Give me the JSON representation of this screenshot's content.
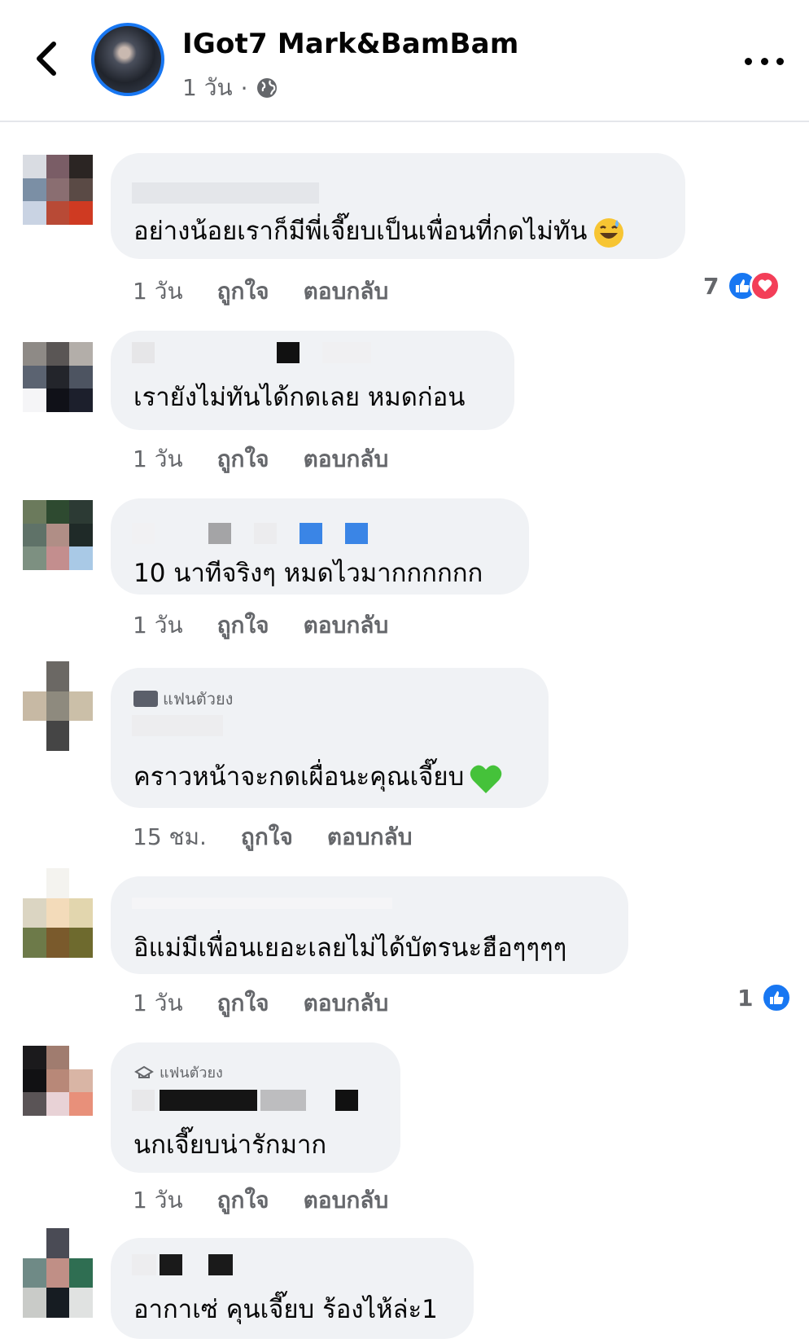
{
  "header": {
    "page_name": "IGot7 Mark&BamBam",
    "time": "1 วัน",
    "separator": "·",
    "back_icon": "chevron-left-icon",
    "privacy_icon": "globe-icon",
    "more_icon": "more-dots-icon"
  },
  "actions": {
    "like": "ถูกใจ",
    "reply": "ตอบกลับ"
  },
  "comments": [
    {
      "text": "อย่างน้อยเราก็มีพี่เจี๊ยบเป็นเพื่อนที่กดไม่ทัน",
      "time": "1 วัน",
      "emoji": "grinning-sweat-emoji",
      "reactions": {
        "count": "7",
        "types": [
          "like",
          "love"
        ]
      }
    },
    {
      "text": "เรายังไม่ทันได้กดเลย หมดก่อน",
      "time": "1 วัน"
    },
    {
      "text": "10 นาทีจริงๆ หมดไวมากกกกกก",
      "time": "1 วัน"
    },
    {
      "fan_badge": "แฟนตัวยง",
      "text": "คราวหน้าจะกดเผื่อนะคุณเจี๊ยบ",
      "time": "15 ชม.",
      "emoji": "green-heart-emoji"
    },
    {
      "text": "อิแม่มีเพื่อนเยอะเลยไม่ได้บัตรนะฮือๆๆๆๆ",
      "time": "1 วัน",
      "reactions": {
        "count": "1",
        "types": [
          "like"
        ]
      }
    },
    {
      "fan_badge": "แฟนตัวยง",
      "text": "นกเจี๊ยบน่ารักมาก",
      "time": "1 วัน"
    },
    {
      "text": "อากาเซ่ คุนเจี๊ยบ ร้องไห้ล่ะ1"
    }
  ],
  "colors": {
    "link_blue": "#1877f2",
    "bubble": "#f0f2f5",
    "secondary_text": "#65676b",
    "love_red": "#f33e58"
  }
}
